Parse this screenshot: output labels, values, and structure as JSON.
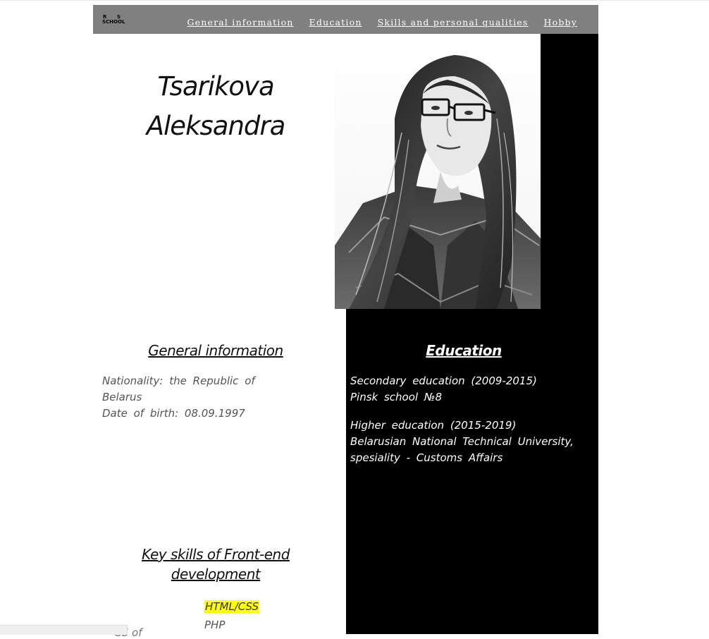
{
  "nav": {
    "logo": {
      "r": "R",
      "s": "S",
      "school": "SCHOOL"
    },
    "links": [
      "General information",
      "Education",
      "Skills and personal qualities",
      "Hobby"
    ]
  },
  "name": {
    "line1": "Tsarikova",
    "line2": "Aleksandra"
  },
  "general": {
    "title": "General information",
    "nationality": "Nationality: the Republic of Belarus",
    "dob": "Date of birth: 08.09.1997"
  },
  "education": {
    "title": "Education",
    "secondary_line1": "Secondary education (2009-2015)",
    "secondary_line2": "Pinsk school №8",
    "higher_line1": "Higher education (2015-2019)",
    "higher_line2": "Belarusian National Technical University, spesiality - Customs Affairs"
  },
  "skills": {
    "title": "Key skills of Front-end development",
    "items": [
      "HTML/CSS",
      "PHP"
    ],
    "cutoff_text": "CS of"
  },
  "colors": {
    "nav_bg": "#808080",
    "highlight": "#ffff00",
    "block": "#000000"
  }
}
